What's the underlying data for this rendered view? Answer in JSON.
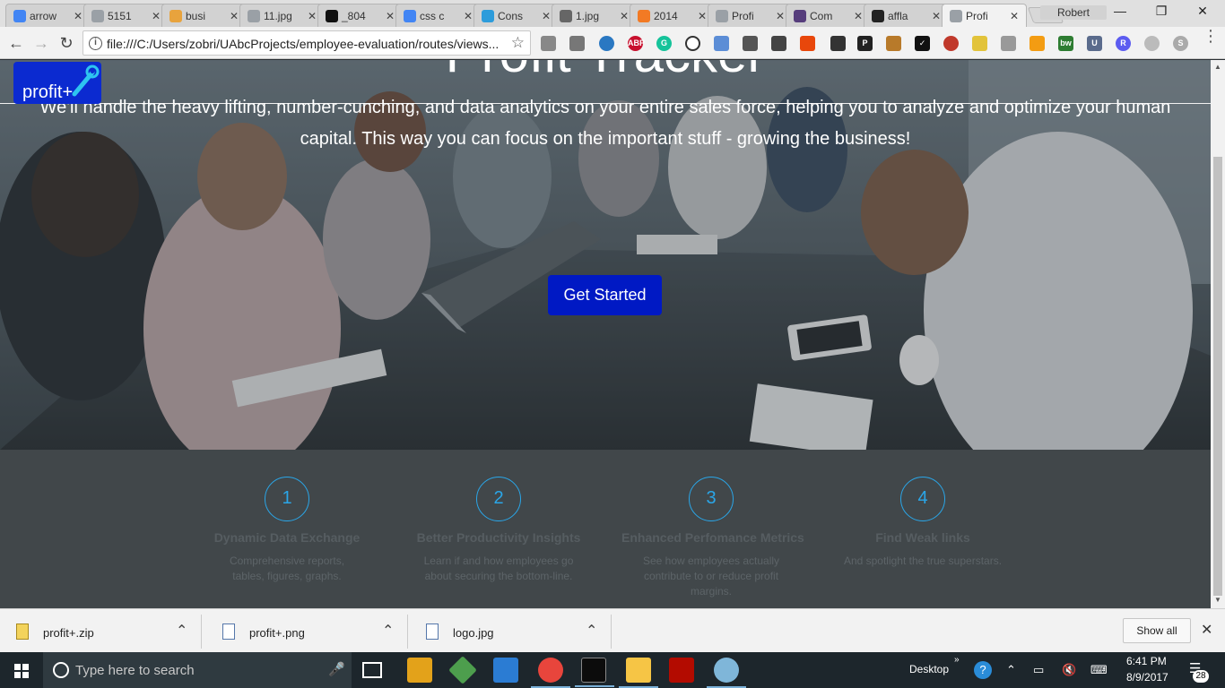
{
  "browser": {
    "tabs": [
      {
        "title": "arrow",
        "icon": "google-icon",
        "color": "#4285f4"
      },
      {
        "title": "5151",
        "icon": "page-icon",
        "color": "#9aa0a6"
      },
      {
        "title": "busi",
        "icon": "image-icon",
        "color": "#e8a33d"
      },
      {
        "title": "11.jpg",
        "icon": "page-icon",
        "color": "#9aa0a6"
      },
      {
        "title": "_804",
        "icon": "bbc-icon",
        "color": "#111111"
      },
      {
        "title": "css c",
        "icon": "google-icon",
        "color": "#4285f4"
      },
      {
        "title": "Cons",
        "icon": "x-app-icon",
        "color": "#2d9cdb"
      },
      {
        "title": "1.jpg",
        "icon": "globe-icon",
        "color": "#666666"
      },
      {
        "title": "2014",
        "icon": "t-icon",
        "color": "#f27a24"
      },
      {
        "title": "Profi",
        "icon": "page-icon",
        "color": "#9aa0a6"
      },
      {
        "title": "Com",
        "icon": "bootstrap-icon",
        "color": "#563d7c"
      },
      {
        "title": "affla",
        "icon": "github-icon",
        "color": "#222222"
      },
      {
        "title": "Profi",
        "icon": "page-icon",
        "color": "#9aa0a6",
        "active": true
      }
    ],
    "user": "Robert",
    "url": "file:///C:/Users/zobri/UAbcProjects/employee-evaluation/routes/views..."
  },
  "hero": {
    "title": "Profit Tracker",
    "subtitle_line1": "We'll handle the heavy lifting, number-cunching, and data analytics on your entire sales force, helping you to analyze and optimize your human",
    "subtitle_line2": "capital. This way you can focus on the important stuff - growing the business!",
    "cta": "Get Started",
    "logo_text": "profit+"
  },
  "features": [
    {
      "num": "1",
      "title": "Dynamic Data Exchange",
      "desc": "Comprehensive reports, tables, figures, graphs."
    },
    {
      "num": "2",
      "title": "Better Productivity Insights",
      "desc": "Learn if and how employees go about securing the bottom-line."
    },
    {
      "num": "3",
      "title": "Enhanced Perfomance Metrics",
      "desc": "See how employees actually contribute to or reduce profit margins."
    },
    {
      "num": "4",
      "title": "Find Weak links",
      "desc": "And spotlight the true superstars."
    }
  ],
  "downloads": [
    {
      "name": "profit+.zip",
      "icon": "zip-icon"
    },
    {
      "name": "profit+.png",
      "icon": "image-file-icon"
    },
    {
      "name": "logo.jpg",
      "icon": "image-file-icon"
    }
  ],
  "show_all": "Show all",
  "taskbar": {
    "search_placeholder": "Type here to search",
    "desktop_label": "Desktop",
    "time": "6:41 PM",
    "date": "8/9/2017",
    "notifications": "28"
  },
  "colors": {
    "cta": "#0019c4",
    "logo": "#0b2ad0",
    "feature_accent": "#2aa6e8"
  }
}
